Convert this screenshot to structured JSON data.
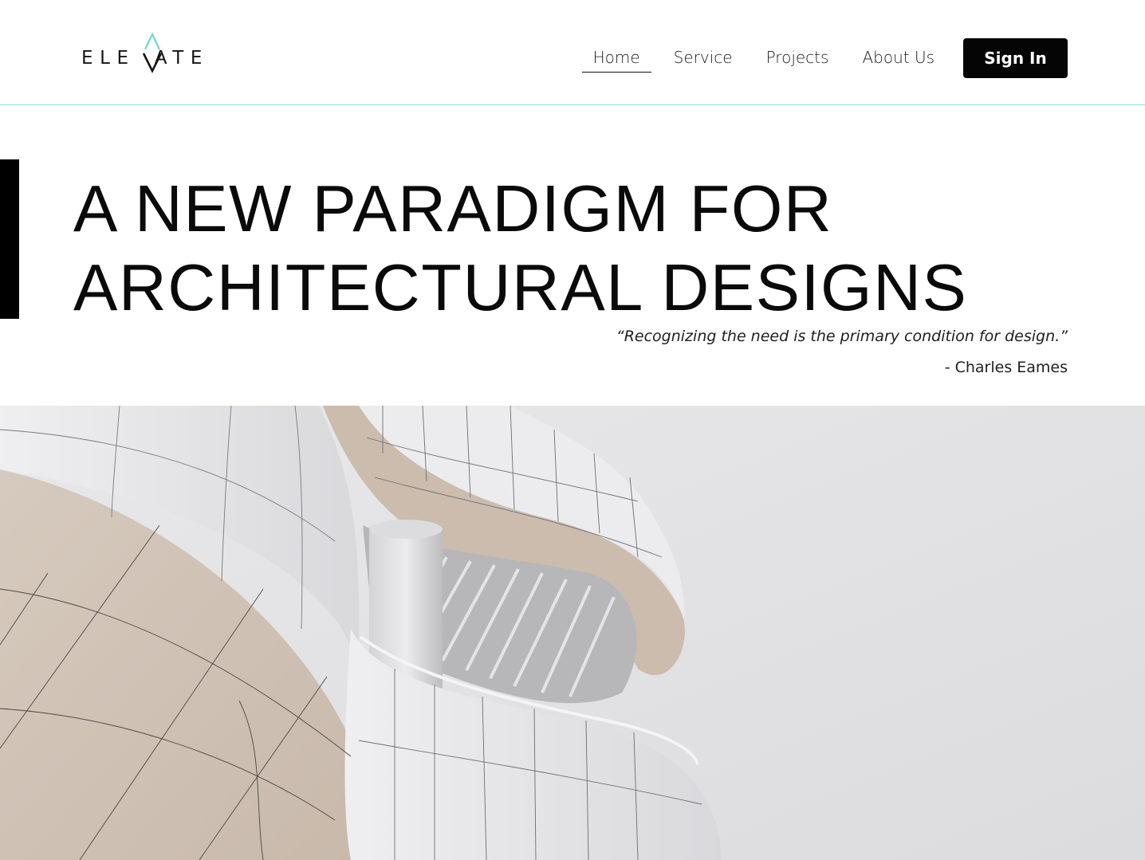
{
  "brand": {
    "name_start": "ELE",
    "name_end": "ATE",
    "accent_color": "#6fd9d3"
  },
  "nav": {
    "items": [
      {
        "label": "Home",
        "active": true
      },
      {
        "label": "Service",
        "active": false
      },
      {
        "label": "Projects",
        "active": false
      },
      {
        "label": "About Us",
        "active": false
      }
    ],
    "signin_label": "Sign In"
  },
  "hero": {
    "headline_line1": "A NEW PARADIGM FOR",
    "headline_line2": "ARCHITECTURAL DESIGNS",
    "quote": "“Recognizing the need is the primary condition for design.”",
    "author": "- Charles Eames"
  },
  "colors": {
    "header_divider": "#8fe0dc",
    "button_bg": "#050505",
    "accent_bar": "#000000"
  }
}
